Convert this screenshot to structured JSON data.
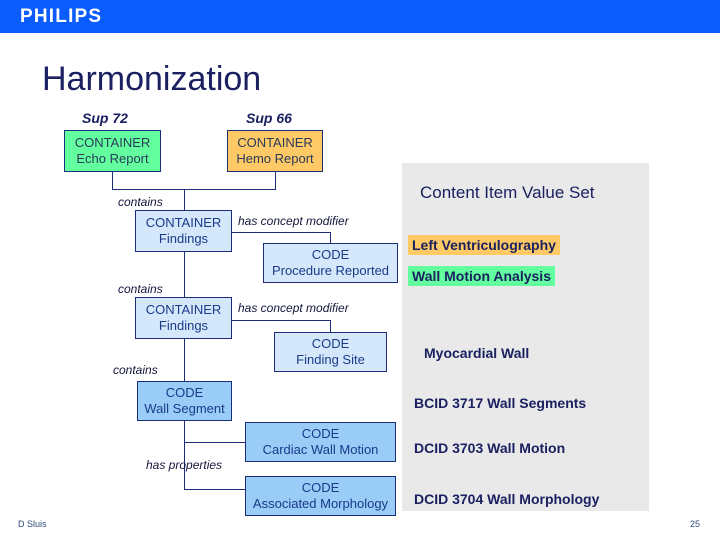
{
  "header": {
    "brand": "PHILIPS",
    "brand_bar_color": "#0a5cfc"
  },
  "slide": {
    "title": "Harmonization",
    "background_color": "#ffffff",
    "text_color": "#1a2060"
  },
  "diagram": {
    "sup_labels": [
      {
        "text": "Sup 72"
      },
      {
        "text": "Sup 66"
      }
    ],
    "nodes": [
      {
        "type": "CONTAINER",
        "name": "Echo Report",
        "color": "#63ff9e"
      },
      {
        "type": "CONTAINER",
        "name": "Hemo Report",
        "color": "#ffc965"
      },
      {
        "type": "CONTAINER",
        "name": "Findings",
        "color": "#d5e8fb"
      },
      {
        "type": "CODE",
        "name": "Procedure Reported",
        "color": "#d5e8fb"
      },
      {
        "type": "CONTAINER",
        "name": "Findings",
        "color": "#d5e8fb"
      },
      {
        "type": "CODE",
        "name": "Finding Site",
        "color": "#d5e8fb"
      },
      {
        "type": "CODE",
        "name": "Wall Segment",
        "color": "#99ccf7"
      },
      {
        "type": "CODE",
        "name": "Cardiac Wall Motion",
        "color": "#99ccf7"
      },
      {
        "type": "CODE",
        "name": "Associated Morphology",
        "color": "#99ccf7"
      }
    ],
    "edge_labels": [
      {
        "text": "contains"
      },
      {
        "text": "has concept modifier"
      },
      {
        "text": "contains"
      },
      {
        "text": "has concept modifier"
      },
      {
        "text": "contains"
      },
      {
        "text": "has properties"
      }
    ]
  },
  "value_set_panel": {
    "heading": "Content Item Value Set",
    "panel_color": "#e9e9e9",
    "items": [
      {
        "text": "Left Ventriculography",
        "highlight": "#ffc965"
      },
      {
        "text": "Wall Motion Analysis",
        "highlight": "#63ff9e"
      },
      {
        "text": "Myocardial Wall",
        "highlight": "none"
      },
      {
        "text": "BCID 3717 Wall Segments",
        "highlight": "none"
      },
      {
        "text": "DCID 3703 Wall Motion",
        "highlight": "none"
      },
      {
        "text": "DCID 3704 Wall Morphology",
        "highlight": "none"
      }
    ]
  },
  "footer": {
    "author": "D Sluis",
    "page_number": "25"
  }
}
